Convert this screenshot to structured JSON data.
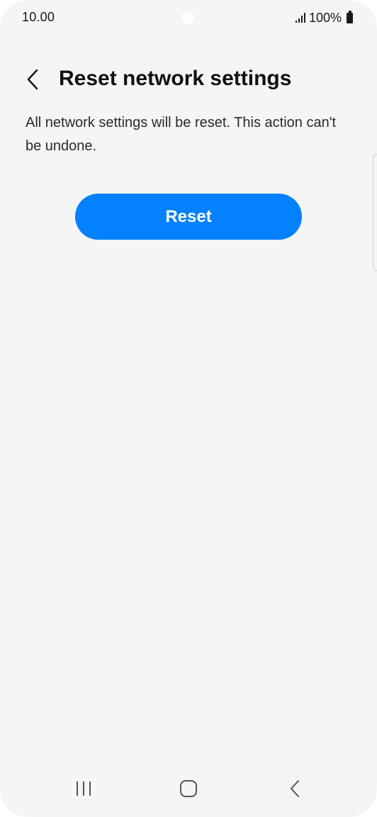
{
  "status_bar": {
    "time": "10.00",
    "battery": "100%",
    "icons": [
      "signal-icon",
      "battery-icon"
    ]
  },
  "header": {
    "title": "Reset network settings",
    "back_icon": "chevron-left-icon"
  },
  "content": {
    "description": "All network settings will be reset. This action can't be undone.",
    "reset_label": "Reset"
  },
  "nav_bar": {
    "icons": [
      "recents-icon",
      "home-icon",
      "back-icon"
    ]
  },
  "colors": {
    "background": "#f5f5f5",
    "accent": "#0381fe",
    "text": "#111111"
  }
}
